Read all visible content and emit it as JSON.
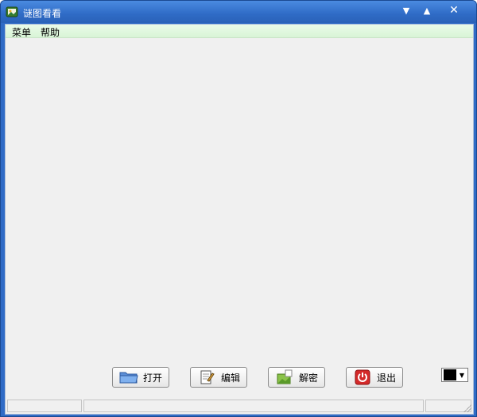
{
  "window": {
    "title": "谜图看看"
  },
  "menubar": {
    "items": [
      {
        "label": "菜单"
      },
      {
        "label": "帮助"
      }
    ]
  },
  "toolbar": {
    "open_label": "打开",
    "edit_label": "编辑",
    "decrypt_label": "解密",
    "exit_label": "退出"
  },
  "colorpicker": {
    "selected_color": "#000000"
  },
  "icons": {
    "app": "picture-app-icon",
    "open": "folder-icon",
    "edit": "notepad-pencil-icon",
    "decrypt": "green-image-icon",
    "exit": "power-icon",
    "minimize": "triangle-down-icon",
    "maximize": "triangle-up-icon",
    "close": "close-x-icon"
  },
  "colors": {
    "titlebar": "#2f6bc6",
    "menubar": "#dff7dd",
    "client": "#f0f0f0",
    "exit_red": "#d42a2a"
  }
}
